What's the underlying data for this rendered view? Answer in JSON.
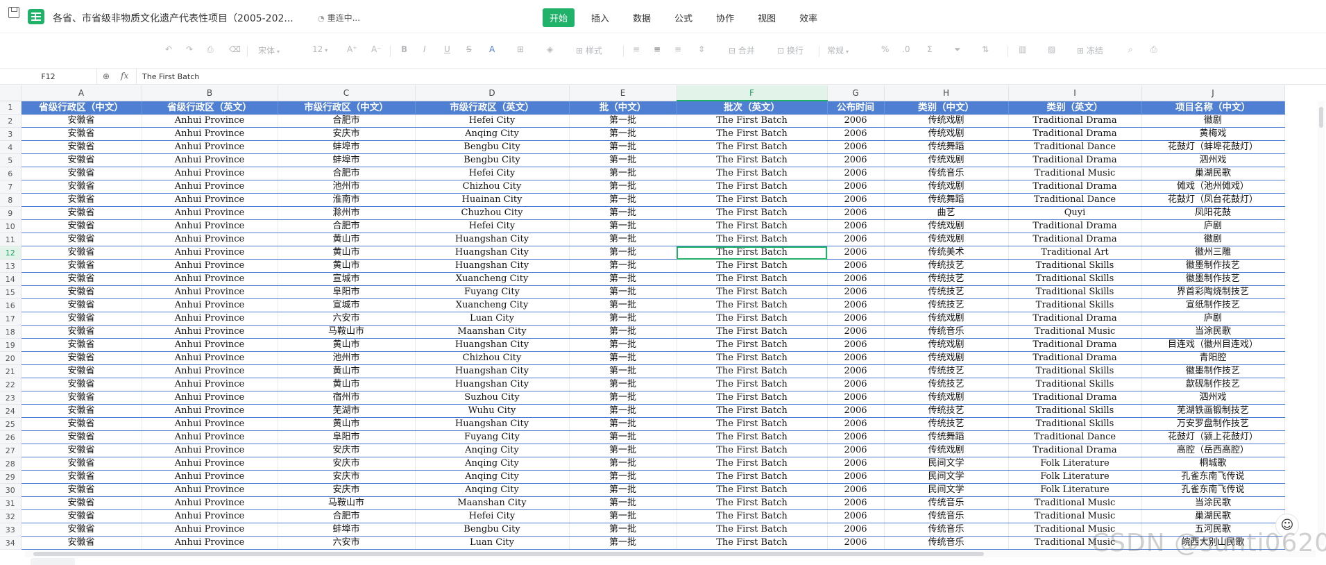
{
  "topbar": {
    "doc_title": "各省、市省级非物质文化遗产代表性项目（2005-202...",
    "reconnect": "重连中...",
    "menu": [
      {
        "label": "开始",
        "active": true
      },
      {
        "label": "插入",
        "active": false
      },
      {
        "label": "数据",
        "active": false
      },
      {
        "label": "公式",
        "active": false
      },
      {
        "label": "协作",
        "active": false
      },
      {
        "label": "视图",
        "active": false
      },
      {
        "label": "效率",
        "active": false
      }
    ]
  },
  "toolbar": {
    "font_name": "宋体",
    "font_size": "12",
    "style_label": "样式",
    "merge_label": "合并",
    "wrap_label": "换行",
    "format_label": "常规",
    "freeze_label": "冻结"
  },
  "formula_bar": {
    "name_box": "F12",
    "fx": "fx",
    "content": "The First Batch"
  },
  "sheet": {
    "columns": [
      "A",
      "B",
      "C",
      "D",
      "E",
      "F",
      "G",
      "H",
      "I",
      "J"
    ],
    "selected_col": "F",
    "selected_row": 12,
    "header": [
      "省级行政区（中文）",
      "省级行政区（英文）",
      "市级行政区（中文）",
      "市级行政区（英文）",
      "批（中文）",
      "批次（英文）",
      "公布时间",
      "类别（中文）",
      "类别（英文）",
      "项目名称（中文）"
    ],
    "rows": [
      [
        "安徽省",
        "Anhui Province",
        "合肥市",
        "Hefei City",
        "第一批",
        "The First Batch",
        "2006",
        "传统戏剧",
        "Traditional Drama",
        "徽剧"
      ],
      [
        "安徽省",
        "Anhui Province",
        "安庆市",
        "Anqing City",
        "第一批",
        "The First Batch",
        "2006",
        "传统戏剧",
        "Traditional Drama",
        "黄梅戏"
      ],
      [
        "安徽省",
        "Anhui Province",
        "蚌埠市",
        "Bengbu City",
        "第一批",
        "The First Batch",
        "2006",
        "传统舞蹈",
        "Traditional Dance",
        "花鼓灯（蚌埠花鼓灯）"
      ],
      [
        "安徽省",
        "Anhui Province",
        "蚌埠市",
        "Bengbu City",
        "第一批",
        "The First Batch",
        "2006",
        "传统戏剧",
        "Traditional Drama",
        "泗州戏"
      ],
      [
        "安徽省",
        "Anhui Province",
        "合肥市",
        "Hefei City",
        "第一批",
        "The First Batch",
        "2006",
        "传统音乐",
        "Traditional Music",
        "巢湖民歌"
      ],
      [
        "安徽省",
        "Anhui Province",
        "池州市",
        "Chizhou City",
        "第一批",
        "The First Batch",
        "2006",
        "传统戏剧",
        "Traditional Drama",
        "傩戏（池州傩戏）"
      ],
      [
        "安徽省",
        "Anhui Province",
        "淮南市",
        "Huainan City",
        "第一批",
        "The First Batch",
        "2006",
        "传统舞蹈",
        "Traditional Dance",
        "花鼓灯（凤台花鼓灯）"
      ],
      [
        "安徽省",
        "Anhui Province",
        "滁州市",
        "Chuzhou City",
        "第一批",
        "The First Batch",
        "2006",
        "曲艺",
        "Quyi",
        "凤阳花鼓"
      ],
      [
        "安徽省",
        "Anhui Province",
        "合肥市",
        "Hefei City",
        "第一批",
        "The First Batch",
        "2006",
        "传统戏剧",
        "Traditional Drama",
        "庐剧"
      ],
      [
        "安徽省",
        "Anhui Province",
        "黄山市",
        "Huangshan City",
        "第一批",
        "The First Batch",
        "2006",
        "传统戏剧",
        "Traditional Drama",
        "徽剧"
      ],
      [
        "安徽省",
        "Anhui Province",
        "黄山市",
        "Huangshan City",
        "第一批",
        "The First Batch",
        "2006",
        "传统美术",
        "Traditional Art",
        "徽州三雕"
      ],
      [
        "安徽省",
        "Anhui Province",
        "黄山市",
        "Huangshan City",
        "第一批",
        "The First Batch",
        "2006",
        "传统技艺",
        "Traditional Skills",
        "徽墨制作技艺"
      ],
      [
        "安徽省",
        "Anhui Province",
        "宣城市",
        "Xuancheng City",
        "第一批",
        "The First Batch",
        "2006",
        "传统技艺",
        "Traditional Skills",
        "徽墨制作技艺"
      ],
      [
        "安徽省",
        "Anhui Province",
        "阜阳市",
        "Fuyang City",
        "第一批",
        "The First Batch",
        "2006",
        "传统技艺",
        "Traditional Skills",
        "界首彩陶烧制技艺"
      ],
      [
        "安徽省",
        "Anhui Province",
        "宣城市",
        "Xuancheng City",
        "第一批",
        "The First Batch",
        "2006",
        "传统技艺",
        "Traditional Skills",
        "宣纸制作技艺"
      ],
      [
        "安徽省",
        "Anhui Province",
        "六安市",
        "Luan City",
        "第一批",
        "The First Batch",
        "2006",
        "传统戏剧",
        "Traditional Drama",
        "庐剧"
      ],
      [
        "安徽省",
        "Anhui Province",
        "马鞍山市",
        "Maanshan City",
        "第一批",
        "The First Batch",
        "2006",
        "传统音乐",
        "Traditional Music",
        "当涂民歌"
      ],
      [
        "安徽省",
        "Anhui Province",
        "黄山市",
        "Huangshan City",
        "第一批",
        "The First Batch",
        "2006",
        "传统戏剧",
        "Traditional Drama",
        "目连戏（徽州目连戏）"
      ],
      [
        "安徽省",
        "Anhui Province",
        "池州市",
        "Chizhou City",
        "第一批",
        "The First Batch",
        "2006",
        "传统戏剧",
        "Traditional Drama",
        "青阳腔"
      ],
      [
        "安徽省",
        "Anhui Province",
        "黄山市",
        "Huangshan City",
        "第一批",
        "The First Batch",
        "2006",
        "传统技艺",
        "Traditional Skills",
        "徽墨制作技艺"
      ],
      [
        "安徽省",
        "Anhui Province",
        "黄山市",
        "Huangshan City",
        "第一批",
        "The First Batch",
        "2006",
        "传统技艺",
        "Traditional Skills",
        "歙砚制作技艺"
      ],
      [
        "安徽省",
        "Anhui Province",
        "宿州市",
        "Suzhou City",
        "第一批",
        "The First Batch",
        "2006",
        "传统戏剧",
        "Traditional Drama",
        "泗州戏"
      ],
      [
        "安徽省",
        "Anhui Province",
        "芜湖市",
        "Wuhu City",
        "第一批",
        "The First Batch",
        "2006",
        "传统技艺",
        "Traditional Skills",
        "芜湖铁画锻制技艺"
      ],
      [
        "安徽省",
        "Anhui Province",
        "黄山市",
        "Huangshan City",
        "第一批",
        "The First Batch",
        "2006",
        "传统技艺",
        "Traditional Skills",
        "万安罗盘制作技艺"
      ],
      [
        "安徽省",
        "Anhui Province",
        "阜阳市",
        "Fuyang City",
        "第一批",
        "The First Batch",
        "2006",
        "传统舞蹈",
        "Traditional Dance",
        "花鼓灯（颍上花鼓灯）"
      ],
      [
        "安徽省",
        "Anhui Province",
        "安庆市",
        "Anqing City",
        "第一批",
        "The First Batch",
        "2006",
        "传统戏剧",
        "Traditional Drama",
        "高腔（岳西高腔）"
      ],
      [
        "安徽省",
        "Anhui Province",
        "安庆市",
        "Anqing City",
        "第一批",
        "The First Batch",
        "2006",
        "民间文学",
        "Folk Literature",
        "桐城歌"
      ],
      [
        "安徽省",
        "Anhui Province",
        "安庆市",
        "Anqing City",
        "第一批",
        "The First Batch",
        "2006",
        "民间文学",
        "Folk Literature",
        "孔雀东南飞传说"
      ],
      [
        "安徽省",
        "Anhui Province",
        "安庆市",
        "Anqing City",
        "第一批",
        "The First Batch",
        "2006",
        "民间文学",
        "Folk Literature",
        "孔雀东南飞传说"
      ],
      [
        "安徽省",
        "Anhui Province",
        "马鞍山市",
        "Maanshan City",
        "第一批",
        "The First Batch",
        "2006",
        "传统音乐",
        "Traditional Music",
        "当涂民歌"
      ],
      [
        "安徽省",
        "Anhui Province",
        "合肥市",
        "Hefei City",
        "第一批",
        "The First Batch",
        "2006",
        "传统音乐",
        "Traditional Music",
        "巢湖民歌"
      ],
      [
        "安徽省",
        "Anhui Province",
        "蚌埠市",
        "Bengbu City",
        "第一批",
        "The First Batch",
        "2006",
        "传统音乐",
        "Traditional Music",
        "五河民歌"
      ],
      [
        "安徽省",
        "Anhui Province",
        "六安市",
        "Luan City",
        "第一批",
        "The First Batch",
        "2006",
        "传统音乐",
        "Traditional Music",
        "皖西大别山民歌"
      ]
    ]
  },
  "watermark": "CSDN @sunti0620",
  "colors": {
    "accent": "#1fb268",
    "header_fill": "#4f7fd3",
    "row_border": "#4a7bd0"
  }
}
